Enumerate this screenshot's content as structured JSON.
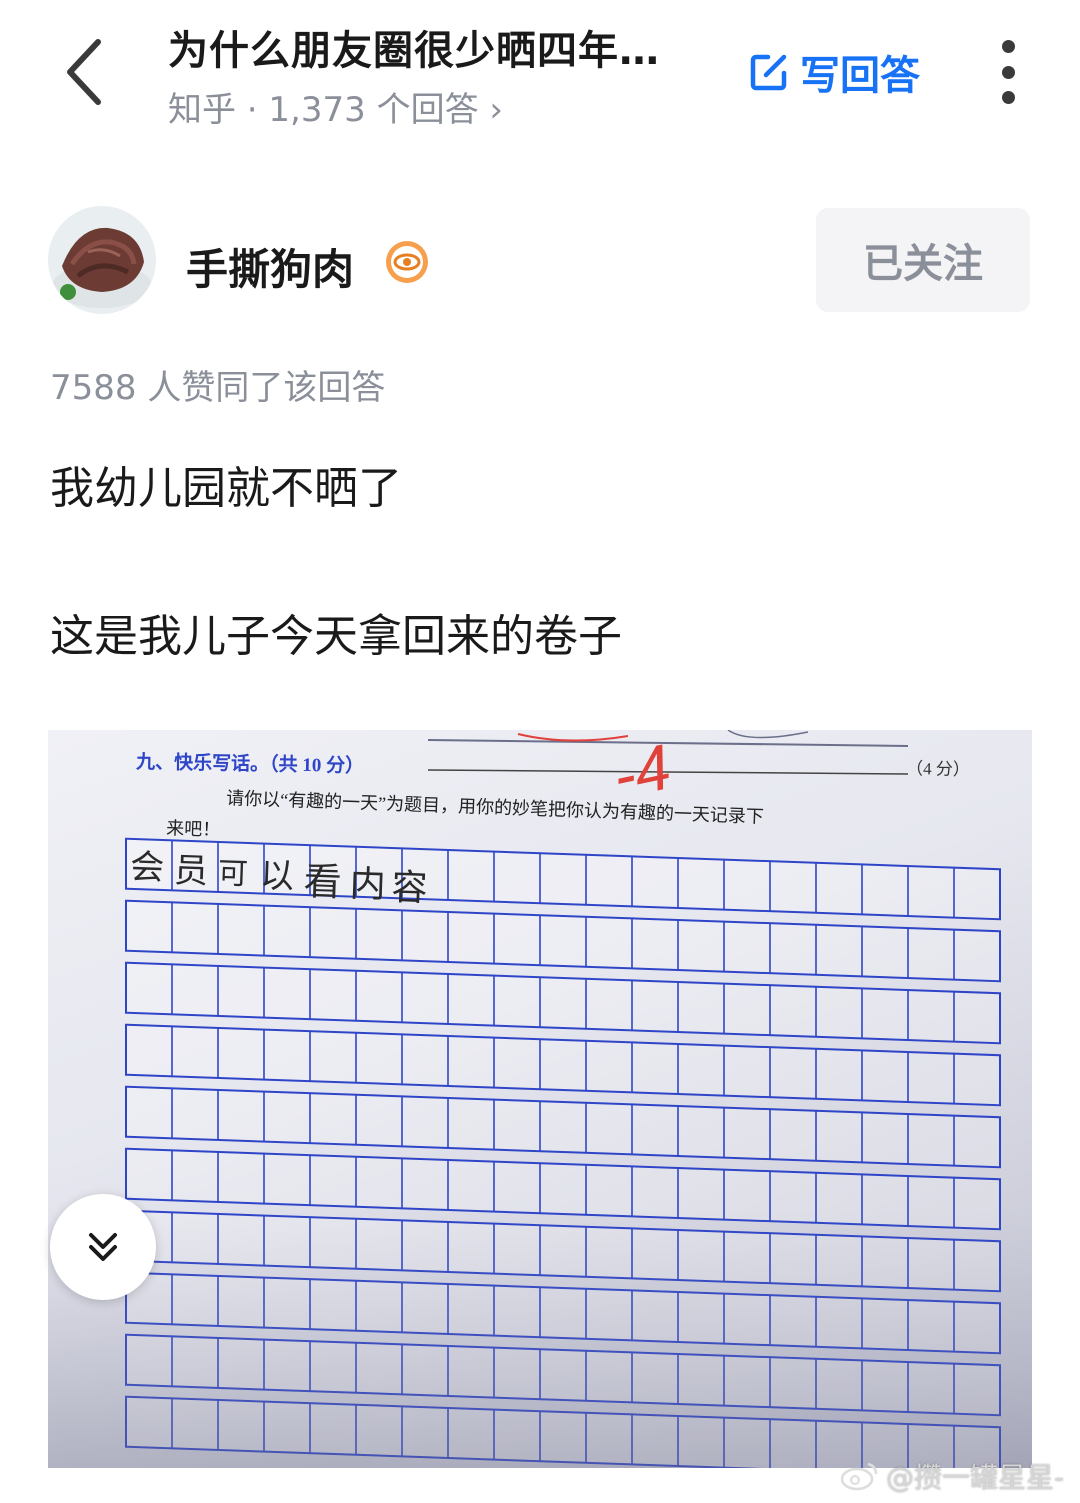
{
  "header": {
    "title": "为什么朋友圈很少晒四年…",
    "subtitle": "知乎 · 1,373 个回答 ›",
    "write_label": "写回答"
  },
  "author": {
    "name": "手撕狗肉",
    "follow_label": "已关注"
  },
  "answer": {
    "votes": "7588 人赞同了该回答",
    "paragraphs": [
      "我幼儿园就不晒了",
      "这是我儿子今天拿回来的卷子"
    ]
  },
  "worksheet": {
    "heading": "九、快乐写话。（共 10 分）",
    "score": "（4 分）",
    "prompt_line1": "请你以“有趣的一天”为题目，用你的妙笔把你认为有趣的一天记录下",
    "prompt_line2": "来吧！",
    "grade_mark": "-4",
    "handwriting": [
      "会",
      "员",
      "可",
      "以",
      "看",
      "内",
      "容"
    ]
  },
  "watermark": "@攒一罐星星-",
  "colors": {
    "accent": "#1772f6",
    "muted": "#8a8f99",
    "grid_blue": "#2f45c8",
    "red_mark": "#e0413a"
  },
  "icons": [
    "back-arrow-icon",
    "edit-icon",
    "more-vertical-icon",
    "eye-badge-icon",
    "double-chevron-down-icon",
    "weibo-icon"
  ]
}
